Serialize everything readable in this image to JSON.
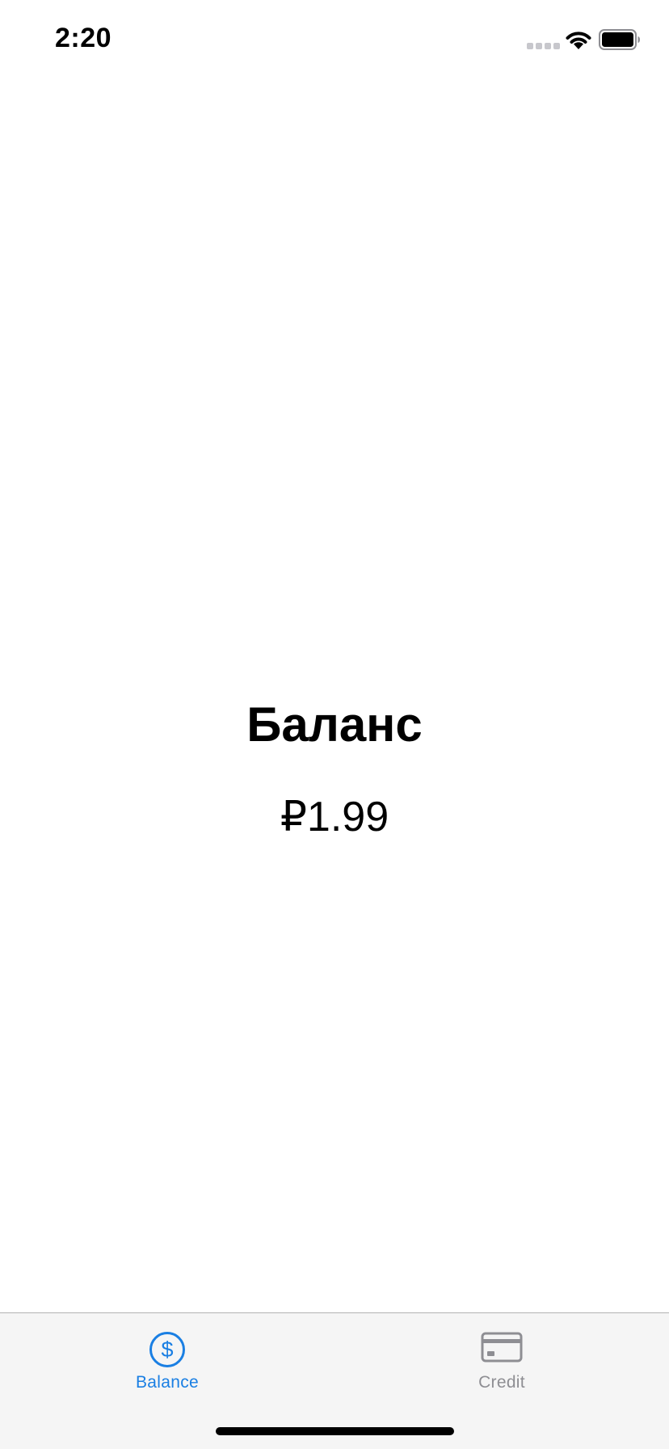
{
  "status_bar": {
    "time": "2:20"
  },
  "main": {
    "title": "Баланс",
    "amount": "₽1.99"
  },
  "tab_bar": {
    "tabs": [
      {
        "label": "Balance",
        "icon": "dollar-circle-icon",
        "selected": true,
        "color": "#1a7fe3"
      },
      {
        "label": "Credit",
        "icon": "credit-card-icon",
        "selected": false,
        "color": "#8e8e93"
      }
    ]
  }
}
